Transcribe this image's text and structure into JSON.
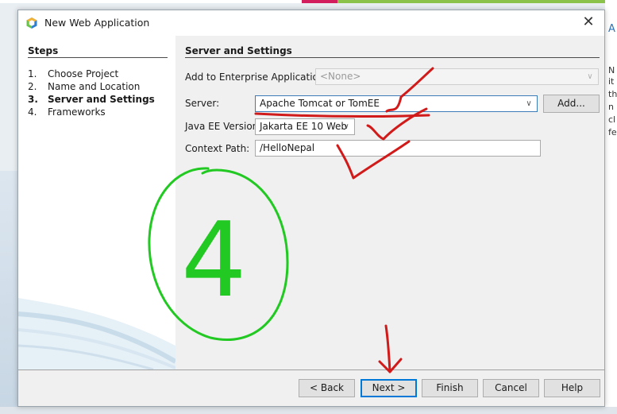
{
  "window": {
    "title": "New Web Application",
    "close_glyph": "✕"
  },
  "background": {
    "right_chars": [
      "A",
      "N",
      "it",
      "th",
      "n",
      "cl",
      "fe"
    ]
  },
  "steps": {
    "heading": "Steps",
    "items": [
      {
        "num": "1.",
        "label": "Choose Project"
      },
      {
        "num": "2.",
        "label": "Name and Location"
      },
      {
        "num": "3.",
        "label": "Server and Settings"
      },
      {
        "num": "4.",
        "label": "Frameworks"
      }
    ]
  },
  "content": {
    "heading": "Server and Settings",
    "enterprise": {
      "label": "Add to Enterprise Application:",
      "value": "<None>"
    },
    "server": {
      "label": "Server:",
      "value": "Apache Tomcat or TomEE",
      "add_button": "Add..."
    },
    "javaee": {
      "label": "Java EE Version:",
      "value": "Jakarta EE 10 Web"
    },
    "context": {
      "label": "Context Path:",
      "value": "/HelloNepal"
    }
  },
  "buttons": {
    "back": "< Back",
    "next": "Next >",
    "finish": "Finish",
    "cancel": "Cancel",
    "help": "Help"
  },
  "annotation": {
    "circled_number": "4",
    "green": "#22c922",
    "red": "#d11a1a"
  },
  "colors": {
    "accent_blue": "#0078d7",
    "panel_gray": "#f0f0f0"
  }
}
